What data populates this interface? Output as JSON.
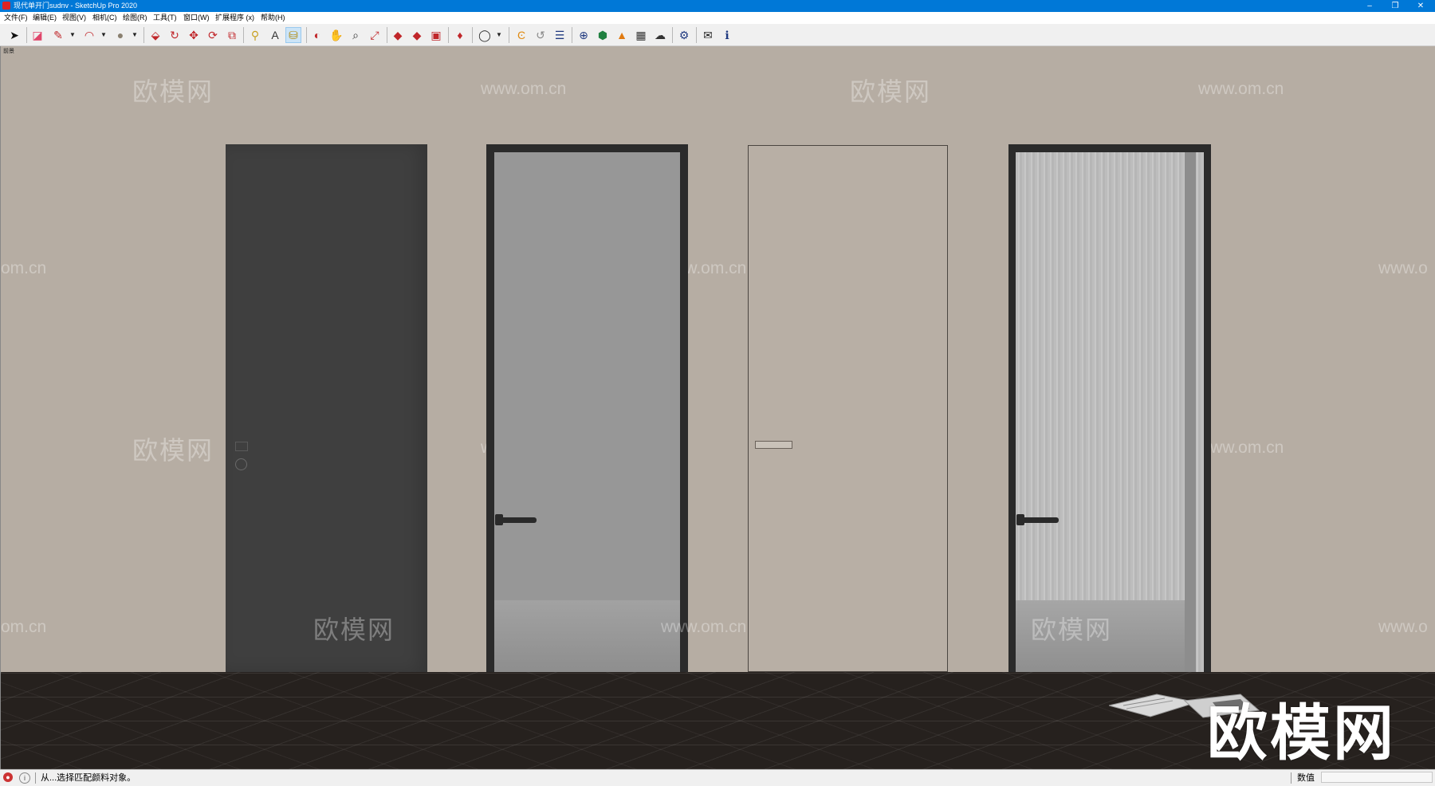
{
  "window": {
    "title": "现代单开门sudnv - SketchUp Pro 2020",
    "controls": [
      "–",
      "❐",
      "✕"
    ]
  },
  "menu": {
    "items": [
      {
        "label": "文件(F)"
      },
      {
        "label": "编辑(E)"
      },
      {
        "label": "视图(V)"
      },
      {
        "label": "相机(C)"
      },
      {
        "label": "绘图(R)"
      },
      {
        "label": "工具(T)"
      },
      {
        "label": "窗口(W)"
      },
      {
        "label": "扩展程序 (x)"
      },
      {
        "label": "帮助(H)"
      }
    ]
  },
  "toolbar": {
    "tools": [
      {
        "name": "select-tool",
        "icon": "arrow-pointer-icon",
        "glyph": "➤",
        "color": "#111111"
      },
      {
        "name": "eraser-tool",
        "icon": "eraser-icon",
        "glyph": "◪",
        "color": "#e0456a"
      },
      {
        "name": "line-tool",
        "icon": "pencil-icon",
        "glyph": "✎",
        "color": "#c0262a"
      },
      {
        "name": "arc-tool",
        "icon": "arc-icon",
        "glyph": "◠",
        "color": "#c0262a"
      },
      {
        "name": "shapes-tool",
        "icon": "circle-icon",
        "glyph": "●",
        "color": "#8a8070"
      },
      {
        "name": "push-pull-tool",
        "icon": "push-pull-icon",
        "glyph": "⬙",
        "color": "#c0262a"
      },
      {
        "name": "offset-tool",
        "icon": "offset-icon",
        "glyph": "↻",
        "color": "#c0262a"
      },
      {
        "name": "move-tool",
        "icon": "move-icon",
        "glyph": "✥",
        "color": "#c0262a"
      },
      {
        "name": "rotate-tool",
        "icon": "rotate-icon",
        "glyph": "⟳",
        "color": "#c0262a"
      },
      {
        "name": "scale-tool",
        "icon": "scale-icon",
        "glyph": "⧉",
        "color": "#c0262a"
      },
      {
        "name": "tape-measure-tool",
        "icon": "tape-measure-icon",
        "glyph": "⚲",
        "color": "#c8a020"
      },
      {
        "name": "text-tool",
        "icon": "text-icon",
        "glyph": "A",
        "color": "#333333"
      },
      {
        "name": "paint-bucket-tool",
        "icon": "paint-bucket-icon",
        "glyph": "⛁",
        "color": "#b08a10"
      },
      {
        "name": "orbit-tool",
        "icon": "orbit-icon",
        "glyph": "◐",
        "color": "#c0262a"
      },
      {
        "name": "pan-tool",
        "icon": "hand-icon",
        "glyph": "✋",
        "color": "#d09a30"
      },
      {
        "name": "zoom-tool",
        "icon": "magnifier-icon",
        "glyph": "⌕",
        "color": "#333333"
      },
      {
        "name": "zoom-extents-tool",
        "icon": "zoom-extents-icon",
        "glyph": "⤢",
        "color": "#c0262a"
      },
      {
        "name": "warehouse-tool",
        "icon": "warehouse-icon",
        "glyph": "◆",
        "color": "#c0262a"
      },
      {
        "name": "share-model-tool",
        "icon": "share-model-icon",
        "glyph": "◆",
        "color": "#c0262a"
      },
      {
        "name": "extension-warehouse-tool",
        "icon": "extension-warehouse-icon",
        "glyph": "▣",
        "color": "#c0262a"
      },
      {
        "name": "ruby-console-tool",
        "icon": "ruby-icon",
        "glyph": "♦",
        "color": "#c0262a"
      },
      {
        "name": "account-tool",
        "icon": "user-circle-icon",
        "glyph": "◯",
        "color": "#333333"
      },
      {
        "name": "plugin-1-tool",
        "icon": "orange-c-icon",
        "glyph": "Ͼ",
        "color": "#e08a10"
      },
      {
        "name": "plugin-2-tool",
        "icon": "refresh-icon",
        "glyph": "↺",
        "color": "#888888"
      },
      {
        "name": "plugin-3-tool",
        "icon": "layers-icon",
        "glyph": "☰",
        "color": "#203a80"
      },
      {
        "name": "plugin-4-tool",
        "icon": "plus-circle-icon",
        "glyph": "⊕",
        "color": "#203a80"
      },
      {
        "name": "plugin-5-tool",
        "icon": "cube-icon",
        "glyph": "⬢",
        "color": "#208040"
      },
      {
        "name": "plugin-6-tool",
        "icon": "terrain-icon",
        "glyph": "▲",
        "color": "#e07a10"
      },
      {
        "name": "plugin-7-tool",
        "icon": "checker-sphere-icon",
        "glyph": "▦",
        "color": "#333333"
      },
      {
        "name": "plugin-8-tool",
        "icon": "cloud-upload-icon",
        "glyph": "☁",
        "color": "#333333"
      },
      {
        "name": "plugin-9-tool",
        "icon": "gear-icon",
        "glyph": "⚙",
        "color": "#203a80"
      },
      {
        "name": "plugin-10-tool",
        "icon": "envelope-icon",
        "glyph": "✉",
        "color": "#222222"
      },
      {
        "name": "plugin-11-tool",
        "icon": "info-icon",
        "glyph": "ℹ",
        "color": "#203a80"
      }
    ]
  },
  "viewport": {
    "scene_label": "前景",
    "watermark_cn": "欧模网",
    "watermark_url": "www.om.cn",
    "watermark_url_partial_left": "om.cn",
    "watermark_url_partial_right": "www.o",
    "logo_text": "欧模网"
  },
  "statusbar": {
    "hint": "从...选择匹配颜料对象。",
    "vcb_label": "数值",
    "vcb_value": ""
  }
}
